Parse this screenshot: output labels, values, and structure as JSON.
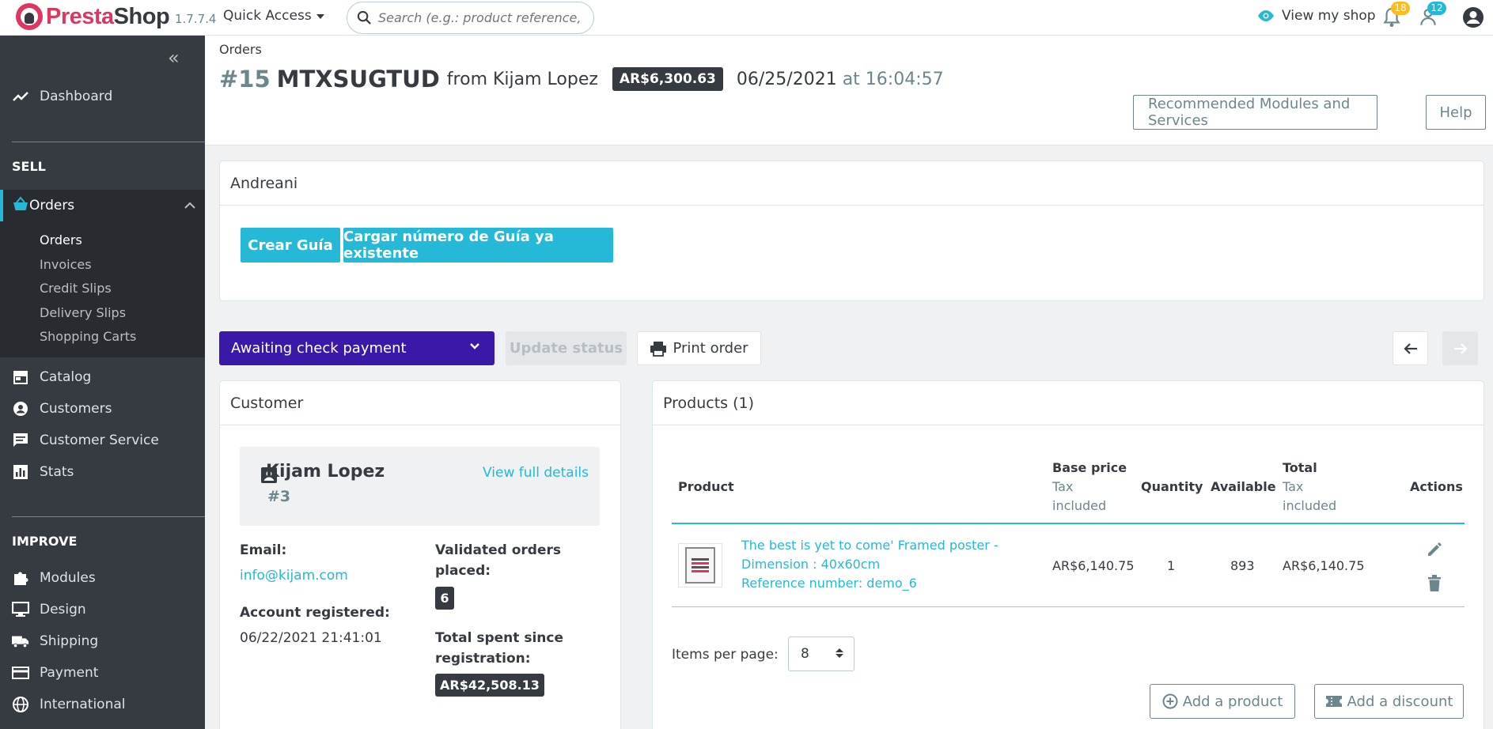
{
  "topbar": {
    "logo_prefix": "Presta",
    "logo_suffix": "Shop",
    "version": "1.7.7.4",
    "quick_access": "Quick Access",
    "search_placeholder": "Search (e.g.: product reference, custo",
    "view_shop": "View my shop",
    "orders_count": "18",
    "customers_count": "12"
  },
  "sidebar": {
    "collapse_label": "«",
    "dashboard": "Dashboard",
    "sell_section": "SELL",
    "orders": "Orders",
    "sub_items": [
      "Orders",
      "Invoices",
      "Credit Slips",
      "Delivery Slips",
      "Shopping Carts"
    ],
    "catalog": "Catalog",
    "customers": "Customers",
    "customer_service": "Customer Service",
    "stats": "Stats",
    "improve_section": "IMPROVE",
    "modules": "Modules",
    "design": "Design",
    "shipping": "Shipping",
    "payment": "Payment",
    "international": "International"
  },
  "header": {
    "breadcrumb": "Orders",
    "order_number": "#15",
    "order_reference": "MTXSUGTUD",
    "from_text": "from Kijam Lopez",
    "total_badge": "AR$6,300.63",
    "date": "06/25/2021",
    "time": "at 16:04:57",
    "recommended_button": "Recommended Modules and Services",
    "help_button": "Help"
  },
  "andreani": {
    "title": "Andreani",
    "create_button": "Crear Guía",
    "load_button": "Cargar número de Guía ya existente"
  },
  "status_bar": {
    "selected_status": "Awaiting check payment",
    "update_button": "Update status",
    "print_button": "Print order"
  },
  "customer": {
    "card_title": "Customer",
    "name": "Kijam Lopez",
    "id": "#3",
    "view_details": "View full details",
    "email_label": "Email:",
    "email": "info@kijam.com",
    "registered_label": "Account registered:",
    "registered_value": "06/22/2021 21:41:01",
    "validated_label_1": "Validated orders",
    "validated_label_2": "placed:",
    "validated_count": "6",
    "spent_label_1": "Total spent since",
    "spent_label_2": "registration:",
    "spent_value": "AR$42,508.13"
  },
  "products": {
    "card_title": "Products (1)",
    "headers": {
      "product": "Product",
      "base_price": "Base price",
      "base_price_sub_1": "Tax",
      "base_price_sub_2": "included",
      "quantity": "Quantity",
      "available": "Available",
      "total": "Total",
      "total_sub_1": "Tax",
      "total_sub_2": "included",
      "actions": "Actions"
    },
    "rows": [
      {
        "name_line_1": "The best is yet to come' Framed poster -",
        "name_line_2": "Dimension : 40x60cm",
        "reference": "Reference number: demo_6",
        "base_price": "AR$6,140.75",
        "quantity": "1",
        "available": "893",
        "total": "AR$6,140.75"
      }
    ],
    "items_per_page_label": "Items per page:",
    "items_per_page_value": "8",
    "add_product_button": "Add a product",
    "add_discount_button": "Add a discount"
  },
  "colors": {
    "accent": "#25b9d7",
    "brand": "#dd3660",
    "status_purple": "#3b19a8",
    "sidebar": "#363a41",
    "orders_badge": "#fbbb22",
    "customers_badge": "#25b9d7"
  },
  "icons": [
    "search-icon",
    "eye-icon",
    "bell-icon",
    "customer-notification-icon",
    "account-icon",
    "trending-icon",
    "basket-icon",
    "store-icon",
    "person-icon",
    "chat-icon",
    "bar-chart-icon",
    "puzzle-icon",
    "desktop-icon",
    "truck-icon",
    "credit-card-icon",
    "globe-icon",
    "printer-icon",
    "arrow-left-icon",
    "arrow-right-icon",
    "id-card-icon",
    "pencil-icon",
    "trash-icon",
    "add-circle-icon",
    "ticket-icon"
  ]
}
